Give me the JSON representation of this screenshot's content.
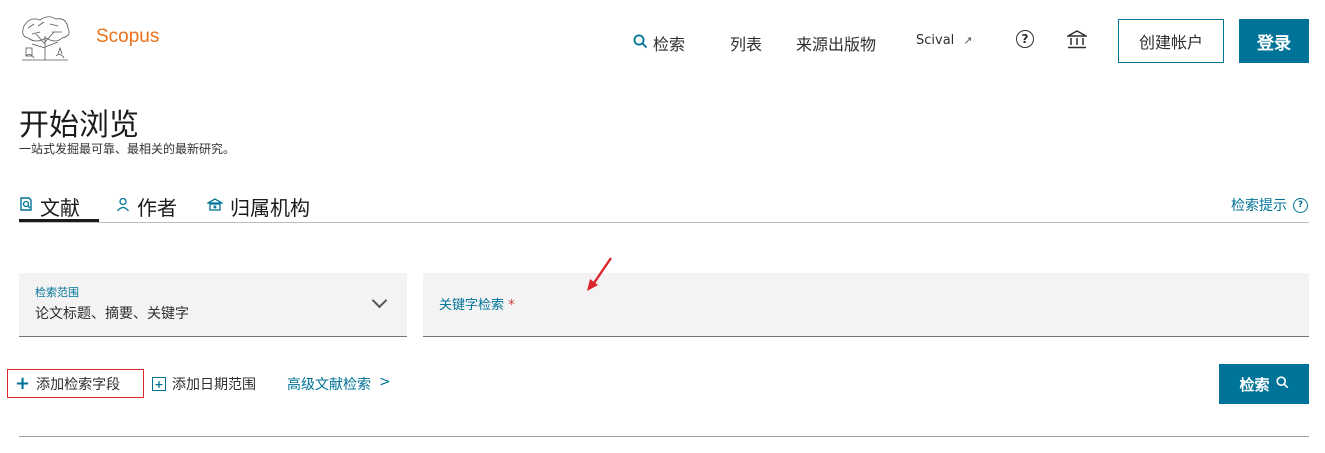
{
  "header": {
    "brand": "Scopus",
    "nav": [
      {
        "label": "检索",
        "icon": "search-icon"
      },
      {
        "label": "列表"
      },
      {
        "label": "来源出版物"
      },
      {
        "label": "Scival",
        "icon": "external-link-icon"
      }
    ],
    "help_glyph": "?",
    "create_account": "创建帐户",
    "login": "登录"
  },
  "page": {
    "title": "开始浏览",
    "subtitle": "一站式发掘最可靠、最相关的最新研究。"
  },
  "tabs": [
    {
      "label": "文献",
      "icon": "document-search-icon",
      "active": true
    },
    {
      "label": "作者",
      "icon": "person-icon"
    },
    {
      "label": "归属机构",
      "icon": "institution-icon"
    }
  ],
  "search_tips": "检索提示",
  "scope": {
    "label": "检索范围",
    "value": "论文标题、摘要、关键字"
  },
  "keyword": {
    "label": "关键字检索",
    "required_mark": "*"
  },
  "actions": {
    "add_field": "添加检索字段",
    "add_date": "添加日期范围",
    "advanced": "高级文献检索",
    "advanced_chevron": ">",
    "search": "检索"
  },
  "colors": {
    "accent": "#007398",
    "brand": "#e9711c",
    "highlight_box": "#d9252b",
    "annotation_arrow": "#d9252b"
  }
}
